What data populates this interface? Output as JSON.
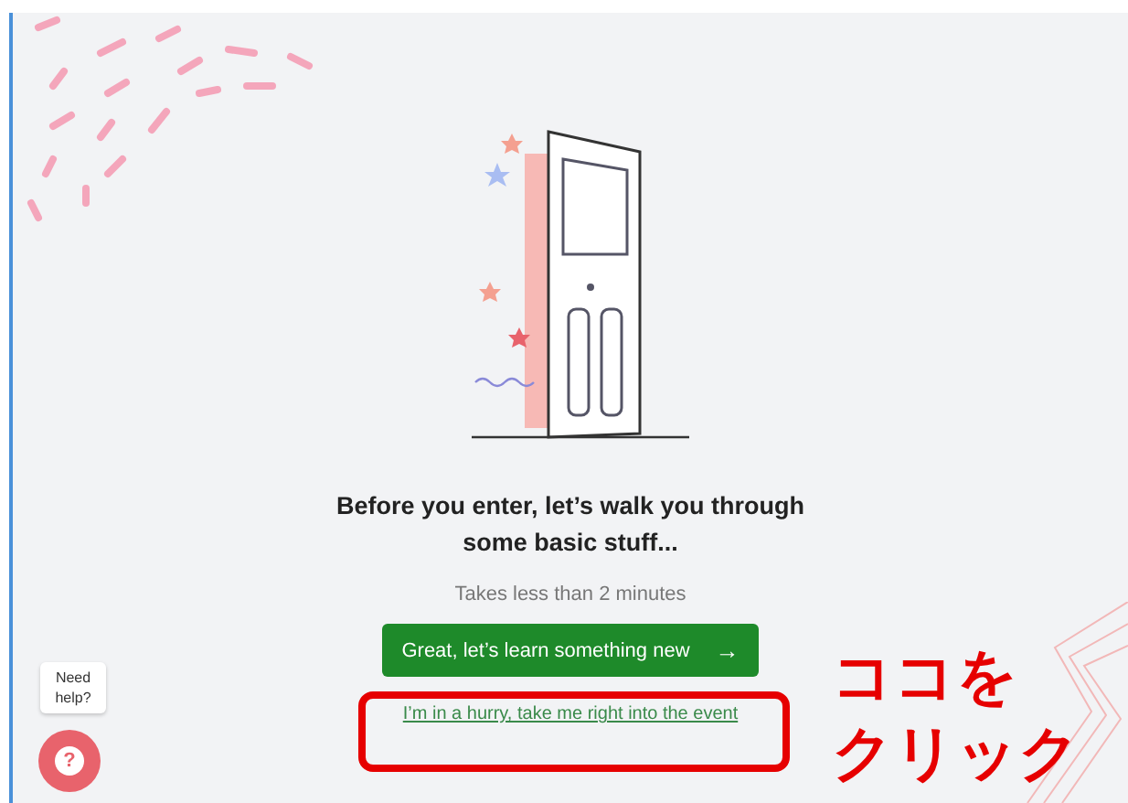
{
  "intro": {
    "heading": "Before you enter, let’s walk you through some basic stuff...",
    "subtitle": "Takes less than 2 minutes"
  },
  "primary_button": {
    "label": "Great, let’s learn something new",
    "arrow": "→"
  },
  "skip_link": {
    "label": "I’m in a hurry, take me right into the event"
  },
  "help": {
    "tooltip": "Need help?",
    "icon_text": "?"
  },
  "annotation": {
    "lines": [
      "ココを",
      "クリック"
    ]
  }
}
